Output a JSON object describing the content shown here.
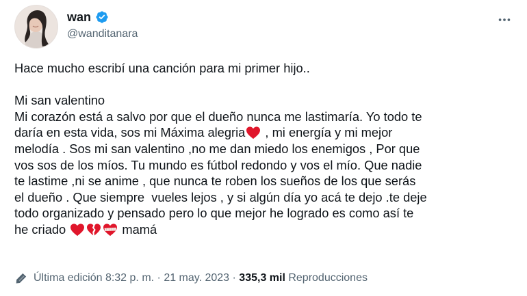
{
  "author": {
    "display_name": "wan",
    "handle": "@wanditanara",
    "verified_icon": "verified-badge-icon",
    "avatar_icon": "profile-photo"
  },
  "menu": {
    "icon": "more-icon"
  },
  "tweet": {
    "intro": "Hace mucho escribí una canción para mi primer hijo..",
    "title": "Mi san valentino",
    "lines": [
      "Mi corazón está a salvo por que el dueño nunca me lastimaría. Yo todo te",
      "daría en esta vida, sos mi Máxima alegria",
      " , mi energía y mi mejor",
      "melodía . Sos mi san valentino ,no me dan miedo los enemigos , Por que",
      "vos sos de los míos. Tu mundo es fútbol redondo y vos el mío. Que nadie",
      "te lastime ,ni se anime , que nunca te roben los sueños de los que serás",
      "el dueño . Que siempre  vueles lejos , y si algún día yo acá te dejo .te deje",
      "todo organizado y pensado pero lo que mejor he logrado es como así te",
      "he criado",
      " mamá"
    ],
    "emojis": [
      "red-heart",
      "red-heart",
      "broken-heart",
      "mending-heart"
    ]
  },
  "meta": {
    "edit_label": "Última edición",
    "time": "8:32 p. m.",
    "sep1": " · ",
    "date": "21 may. 2023",
    "sep2": " · ",
    "views_count": "335,3 mil",
    "views_label": " Reproducciones",
    "edit_icon": "pencil-icon"
  },
  "colors": {
    "text": "#0f1419",
    "secondary": "#536471",
    "verified": "#1d9bf0",
    "heart": "#e0162b"
  }
}
